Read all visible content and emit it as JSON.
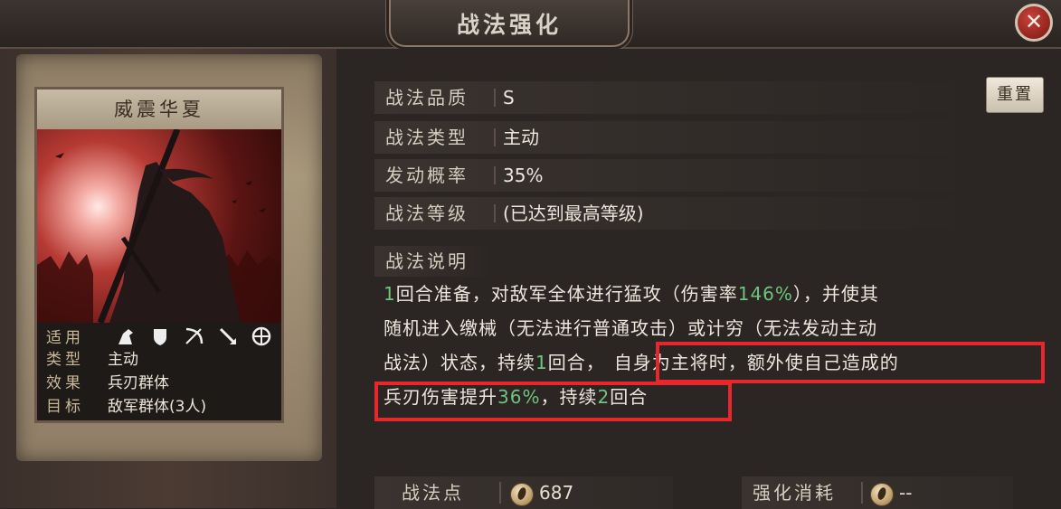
{
  "header": {
    "title": "战法强化",
    "close_label": "✕"
  },
  "card": {
    "name": "威震华夏",
    "info": [
      {
        "key": "适用",
        "value": ""
      },
      {
        "key": "类型",
        "value": "主动"
      },
      {
        "key": "效果",
        "value": "兵刃群体"
      },
      {
        "key": "目标",
        "value": "敌军群体(3人)"
      }
    ],
    "troop_icons": [
      "cavalry-icon",
      "shield-icon",
      "bow-icon",
      "spear-icon",
      "wheel-icon"
    ]
  },
  "attributes": [
    {
      "key": "战法品质",
      "value": "S"
    },
    {
      "key": "战法类型",
      "value": "主动"
    },
    {
      "key": "发动概率",
      "value": "35%"
    },
    {
      "key": "战法等级",
      "value": "(已达到最高等级)"
    }
  ],
  "reset_label": "重置",
  "description": {
    "heading": "战法说明",
    "line1_a": "1",
    "line1_b": "回合准备，对敌军全体进行猛攻（伤害率",
    "line1_c": "146%",
    "line1_d": "），并使其",
    "line2": "随机进入缴械（无法进行普通攻击）或计穷（无法发动主动",
    "line3_a": "战法）状态，持续",
    "line3_b": "1",
    "line3_c": "回合，",
    "line3_d": "自身为主将时，额外使自己造成的",
    "line4_a": "兵刃伤害提升",
    "line4_b": "36%",
    "line4_c": "，持续",
    "line4_d": "2",
    "line4_e": "回合"
  },
  "footer": {
    "points_label": "战法点",
    "points_value": "687",
    "cost_label": "强化消耗",
    "cost_value": "--"
  },
  "colors": {
    "highlight": "#e8262c",
    "value_green": "#6fc47d"
  }
}
